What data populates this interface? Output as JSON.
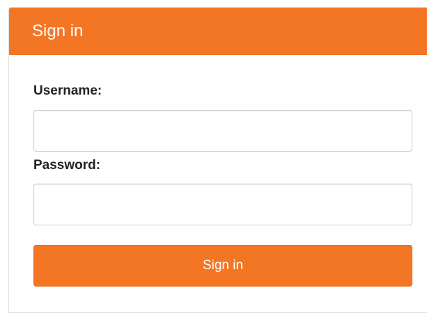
{
  "header": {
    "title": "Sign in"
  },
  "form": {
    "username_label": "Username:",
    "username_value": "",
    "password_label": "Password:",
    "password_value": "",
    "submit_label": "Sign in"
  },
  "colors": {
    "accent": "#f37625",
    "header_text": "#ffffff",
    "label_text": "#222222"
  }
}
